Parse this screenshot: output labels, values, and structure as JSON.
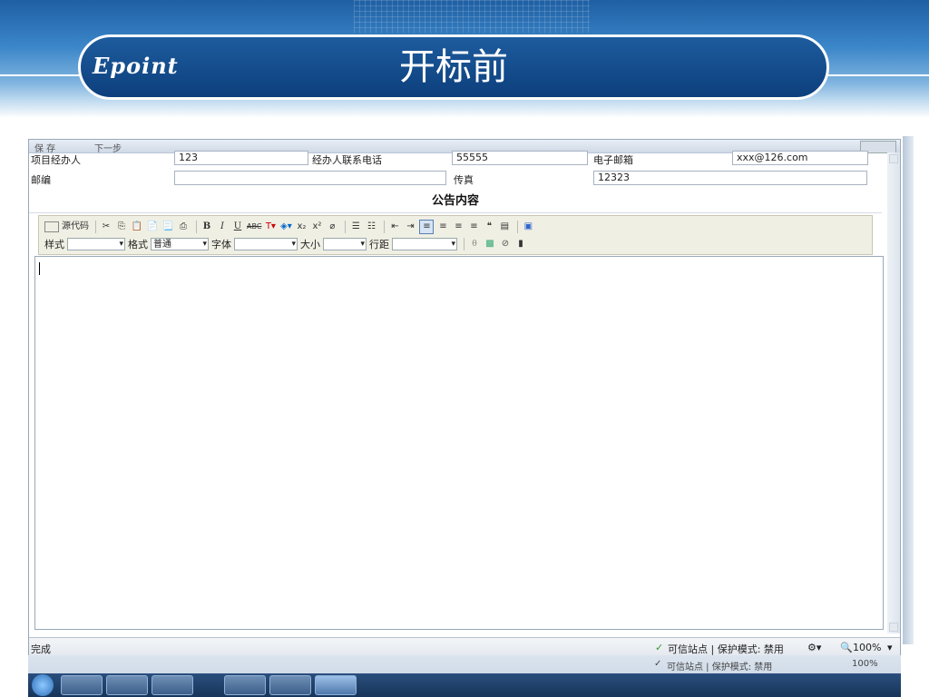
{
  "slide": {
    "logo": "Epoint",
    "title": "开标前"
  },
  "window": {
    "toolbar_fragments": [
      "保 存",
      "下一步"
    ],
    "row1": {
      "label1": "项目经办人",
      "value1": "123",
      "label2": "经办人联系电话",
      "value2": "55555",
      "label3": "电子邮箱",
      "value3": "xxx@126.com"
    },
    "row2": {
      "label_postcode": "邮编",
      "postcode_value": "",
      "label_fax": "传真",
      "fax_value": "12323"
    },
    "section_title": "公告内容",
    "editor_toolbar": {
      "source_label": "源代码",
      "bold": "B",
      "italic": "I",
      "underline": "U",
      "strike": "ABC",
      "subscript": "x₂",
      "superscript": "x²",
      "style_label": "样式",
      "format_label": "格式",
      "format_value": "普通",
      "font_label": "字体",
      "size_label": "大小",
      "line_height_label": "行距"
    },
    "editor_content": ""
  },
  "status": {
    "left": "完成",
    "trusted": "可信站点 | 保护模式: 禁用",
    "zoom": "100%"
  },
  "echo_status": {
    "trusted": "可信站点 | 保护模式: 禁用",
    "zoom": "100%"
  }
}
